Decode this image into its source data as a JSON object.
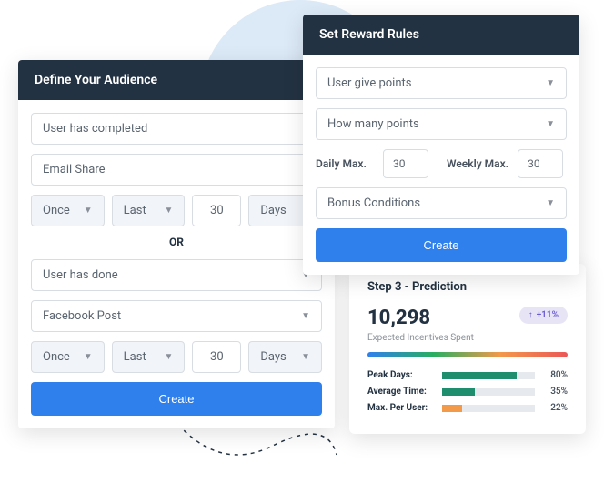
{
  "audience": {
    "title": "Define Your Audience",
    "block1": {
      "condition": "User has completed",
      "channel": "Email Share",
      "freq": "Once",
      "rangeType": "Last",
      "rangeValue": "30",
      "rangeUnit": "Days"
    },
    "or": "OR",
    "block2": {
      "condition": "User has done",
      "channel": "Facebook Post",
      "freq": "Once",
      "rangeType": "Last",
      "rangeValue": "30",
      "rangeUnit": "Days"
    },
    "createLabel": "Create"
  },
  "reward": {
    "title": "Set Reward Rules",
    "action": "User give points",
    "amount": "How many points",
    "dailyLabel": "Daily Max.",
    "dailyValue": "30",
    "weeklyLabel": "Weekly Max.",
    "weeklyValue": "30",
    "bonus": "Bonus Conditions",
    "createLabel": "Create"
  },
  "prediction": {
    "title": "Step 3 - Prediction",
    "number": "10,298",
    "sub": "Expected Incentives Spent",
    "badge": "+11%",
    "stats": [
      {
        "label": "Peak Days:",
        "pct": 80,
        "color": "#1e8e6e"
      },
      {
        "label": "Average Time:",
        "pct": 35,
        "color": "#1e8e6e"
      },
      {
        "label": "Max. Per User:",
        "pct": 22,
        "color": "#f2994a"
      }
    ]
  }
}
